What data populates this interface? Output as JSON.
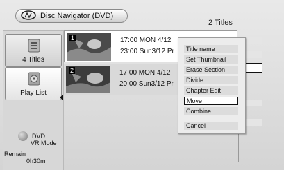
{
  "header": {
    "title": "Disc Navigator (DVD)",
    "title_count": "2 Titles"
  },
  "sidebar": {
    "items": [
      {
        "label": "4 Titles",
        "icon": "list-icon"
      },
      {
        "label": "Play List",
        "icon": "playlist-icon"
      }
    ],
    "mode_line1": "DVD",
    "mode_line2": "VR Mode",
    "remain_label": "Remain",
    "remain_time": "0h30m"
  },
  "titles": [
    {
      "number": "1",
      "line1": "17:00 MON  4/12",
      "line2": "23:00  Sun3/12  Pr"
    },
    {
      "number": "2",
      "line1": "17:00 MON  4/12",
      "line2": "20:00  Sun3/12  Pr"
    }
  ],
  "menu": {
    "items": [
      {
        "label": "Title name",
        "highlighted": false
      },
      {
        "label": "Set Thumbnail",
        "highlighted": false
      },
      {
        "label": "Erase Section",
        "highlighted": false
      },
      {
        "label": "Divide",
        "highlighted": false
      },
      {
        "label": "Chapter Edit",
        "highlighted": false
      },
      {
        "label": "Move",
        "highlighted": true
      },
      {
        "label": "Combine",
        "highlighted": false
      },
      {
        "label": "Cancel",
        "highlighted": false
      }
    ]
  }
}
